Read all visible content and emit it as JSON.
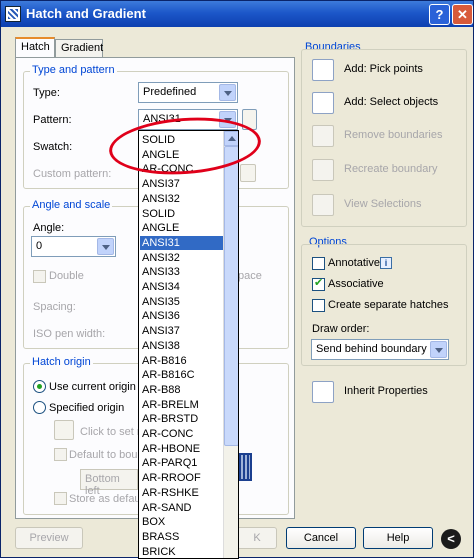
{
  "window": {
    "title": "Hatch and Gradient",
    "help_label": "?",
    "close_label": "✕"
  },
  "tabs": [
    {
      "label": "Hatch"
    },
    {
      "label": "Gradient"
    }
  ],
  "type_pattern": {
    "title": "Type and pattern",
    "type_label": "Type:",
    "type_value": "Predefined",
    "pattern_label": "Pattern:",
    "pattern_value": "ANSI31",
    "swatch_label": "Swatch:",
    "custom_pattern_label": "Custom pattern:"
  },
  "angle_scale": {
    "title": "Angle and scale",
    "angle_label": "Angle:",
    "angle_value": "0",
    "double_label": "Double",
    "relative_space_fragment": "pace",
    "spacing_label": "Spacing:",
    "iso_pen_label": "ISO pen width:"
  },
  "hatch_origin": {
    "title": "Hatch origin",
    "use_current_label": "Use current origin",
    "specified_label": "Specified origin",
    "click_to_set_label": "Click to set n",
    "default_to_boundary_label": "Default to bound",
    "bottom_left_value": "Bottom left",
    "store_as_default_label": "Store as default"
  },
  "pattern_dropdown": {
    "items": [
      "SOLID",
      "ANGLE",
      "AR-CONC",
      "ANSI37",
      "ANSI32",
      "SOLID",
      "ANGLE",
      "ANSI31",
      "ANSI32",
      "ANSI33",
      "ANSI34",
      "ANSI35",
      "ANSI36",
      "ANSI37",
      "ANSI38",
      "AR-B816",
      "AR-B816C",
      "AR-B88",
      "AR-BRELM",
      "AR-BRSTD",
      "AR-CONC",
      "AR-HBONE",
      "AR-PARQ1",
      "AR-RROOF",
      "AR-RSHKE",
      "AR-SAND",
      "BOX",
      "BRASS",
      "BRICK"
    ],
    "selected_index": 7
  },
  "boundaries": {
    "title": "Boundaries",
    "add_pick_points": "Add: Pick points",
    "add_select_objects": "Add: Select objects",
    "remove_boundaries": "Remove boundaries",
    "recreate_boundary": "Recreate boundary",
    "view_selections": "View Selections"
  },
  "options": {
    "title": "Options",
    "annotative_label": "Annotative",
    "annotative_checked": false,
    "associative_label": "Associative",
    "associative_checked": true,
    "separate_hatches_label": "Create separate hatches",
    "separate_hatches_checked": false,
    "draw_order_label": "Draw order:",
    "draw_order_value": "Send behind boundary"
  },
  "inherit_properties": "Inherit Properties",
  "footer": {
    "preview": "Preview",
    "ok_fragment": "K",
    "cancel": "Cancel",
    "help": "Help",
    "expand": "<"
  },
  "colors": {
    "accent": "#0046d5",
    "selection": "#316ac5",
    "annotation": "#e0001a"
  }
}
